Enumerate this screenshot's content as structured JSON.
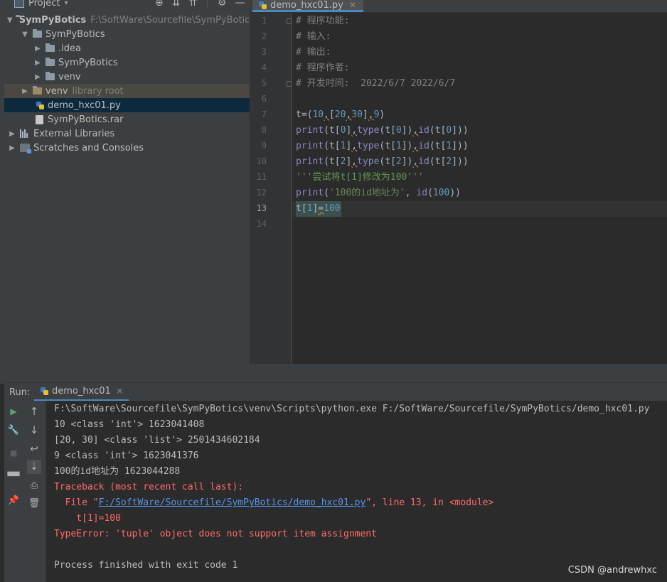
{
  "project_panel": {
    "title": "Project",
    "tree": [
      {
        "label": "SymPyBotics",
        "hint": "F:\\SoftWare\\Sourcefile\\SymPyBotics"
      },
      {
        "label": "SymPyBotics"
      },
      {
        "label": ".idea"
      },
      {
        "label": "SymPyBotics"
      },
      {
        "label": "venv"
      },
      {
        "label": "venv",
        "hint": "library root"
      },
      {
        "label": "demo_hxc01.py"
      },
      {
        "label": "SymPyBotics.rar"
      },
      {
        "label": "External Libraries"
      },
      {
        "label": "Scratches and Consoles"
      }
    ]
  },
  "editor": {
    "tab_label": "demo_hxc01.py",
    "line_numbers": [
      "1",
      "2",
      "3",
      "4",
      "5",
      "6",
      "7",
      "8",
      "9",
      "10",
      "11",
      "12",
      "13",
      "14"
    ],
    "current_line": 13,
    "code": {
      "l1": "# 程序功能:",
      "l2": "# 输入:",
      "l3": "# 输出:",
      "l4": "# 程序作者:",
      "l5": "# 开发时间:  2022/6/7 2022/6/7",
      "l11": "'''尝试将t[1]修改为100'''",
      "l12_str": "'100的id地址为'"
    }
  },
  "run_panel": {
    "label": "Run:",
    "tab_label": "demo_hxc01",
    "output": [
      "F:\\SoftWare\\Sourcefile\\SymPyBotics\\venv\\Scripts\\python.exe F:/SoftWare/Sourcefile/SymPyBotics/demo_hxc01.py",
      "10 <class 'int'> 1623041408",
      "[20, 30] <class 'list'> 2501434602184",
      "9 <class 'int'> 1623041376",
      "100的id地址为 1623044288",
      "Traceback (most recent call last):",
      "  File \"",
      "F:/SoftWare/Sourcefile/SymPyBotics/demo_hxc01.py",
      "\", line 13, in <module>",
      "    t[1]=100",
      "TypeError: 'tuple' object does not support item assignment",
      "",
      "Process finished with exit code 1"
    ]
  },
  "watermark": "CSDN @andrewhxc",
  "colors": {
    "background": "#2b2b2b",
    "panel": "#3c3f41",
    "selection": "#0d293e",
    "error": "#ff6b68",
    "link": "#5394ec",
    "comment": "#808080",
    "docstring": "#629755",
    "number": "#6897bb",
    "builtin": "#8888c6"
  }
}
